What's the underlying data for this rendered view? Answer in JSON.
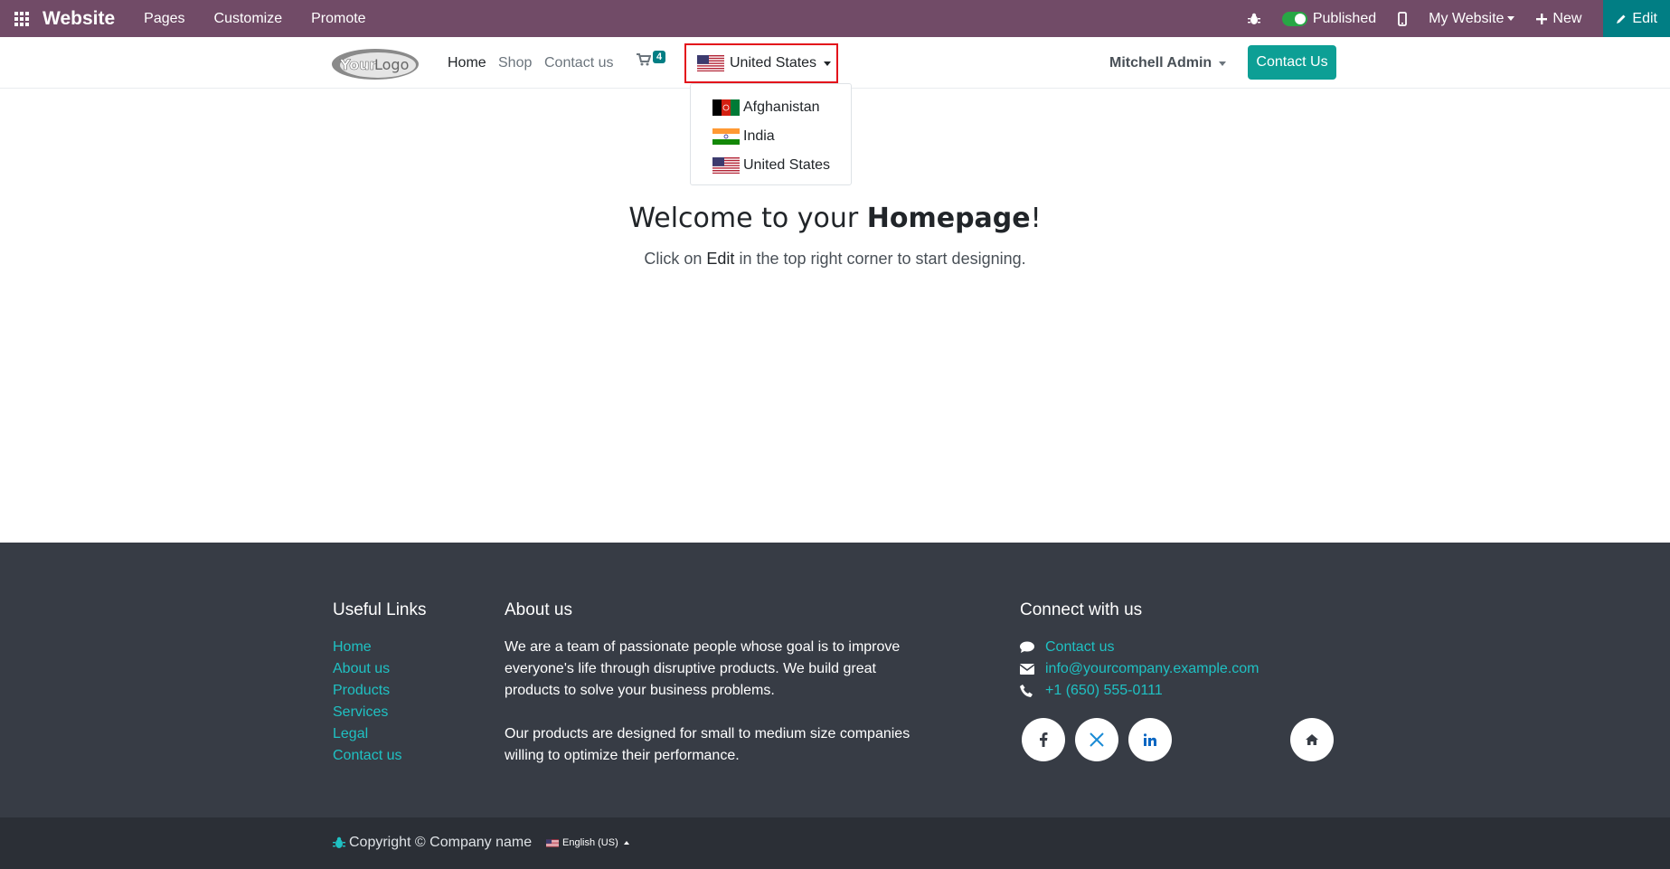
{
  "adminbar": {
    "brand": "Website",
    "menus": [
      "Pages",
      "Customize",
      "Promote"
    ],
    "published_label": "Published",
    "website_selector": "My Website",
    "new_label": "New",
    "edit_label": "Edit",
    "color": "#714b67",
    "edit_color": "#017e84"
  },
  "header": {
    "logo_text_your": "Your",
    "logo_text_logo": "Logo",
    "nav": [
      "Home",
      "Shop",
      "Contact us"
    ],
    "cart_count": "4",
    "country_selected": "United States",
    "user_name": "Mitchell Admin",
    "contact_button": "Contact Us"
  },
  "country_dropdown": {
    "items": [
      "Afghanistan",
      "India",
      "United States"
    ]
  },
  "hero": {
    "title_prefix": "Welcome to your ",
    "title_bold": "Homepage",
    "title_suffix": "!",
    "sub_prefix": "Click on ",
    "sub_bold": "Edit",
    "sub_suffix": " in the top right corner to start designing."
  },
  "footer": {
    "useful_links_title": "Useful Links",
    "useful_links": [
      "Home",
      "About us",
      "Products",
      "Services",
      "Legal",
      "Contact us"
    ],
    "about_title": "About us",
    "about_p1": "We are a team of passionate people whose goal is to improve everyone's life through disruptive products. We build great products to solve your business problems.",
    "about_p2": "Our products are designed for small to medium size companies willing to optimize their performance.",
    "connect_title": "Connect with us",
    "contact_us": "Contact us",
    "email": "info@yourcompany.example.com",
    "phone": "+1 (650) 555-0111",
    "socials": [
      "facebook-icon",
      "x-icon",
      "linkedin-icon",
      "home-icon"
    ],
    "link_color": "#1fc1c3",
    "background": "#373c45"
  },
  "copyright": {
    "text": "Copyright © Company name",
    "language": "English (US)"
  }
}
